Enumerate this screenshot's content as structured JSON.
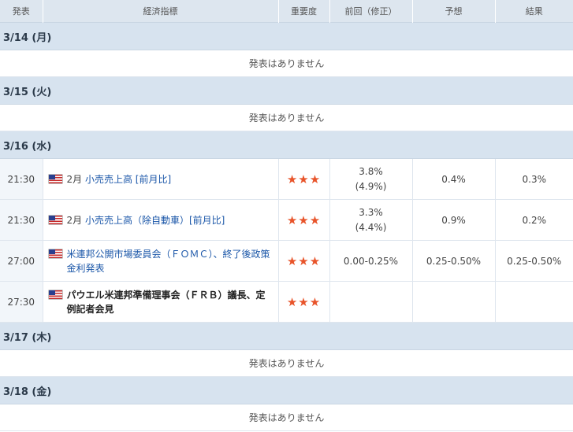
{
  "columns": [
    "発表",
    "経済指標",
    "重要度",
    "前回（修正）",
    "予想",
    "結果"
  ],
  "no_release_text": "発表はありません",
  "days": [
    {
      "date": "3/14 (月)"
    },
    {
      "date": "3/15 (火)"
    },
    {
      "date": "3/16 (水)"
    },
    {
      "date": "3/17 (木)"
    },
    {
      "date": "3/18 (金)"
    }
  ],
  "events": [
    {
      "time": "21:30",
      "month": "2月",
      "name": "小売売上高 [前月比]",
      "stars": "★★★",
      "previous": "3.8%",
      "revised": "(4.9%)",
      "forecast": "0.4%",
      "actual": "0.3%"
    },
    {
      "time": "21:30",
      "month": "2月",
      "name": "小売売上高（除自動車）[前月比]",
      "stars": "★★★",
      "previous": "3.3%",
      "revised": "(4.4%)",
      "forecast": "0.9%",
      "actual": "0.2%"
    },
    {
      "time": "27:00",
      "name": "米連邦公開市場委員会（ＦＯＭＣ）、終了後政策金利発表",
      "stars": "★★★",
      "previous": "0.00-0.25%",
      "forecast": "0.25-0.50%",
      "actual": "0.25-0.50%"
    },
    {
      "time": "27:30",
      "name": "パウエル米連邦準備理事会（ＦＲＢ）議長、定例記者会見",
      "stars": "★★★",
      "previous": "",
      "forecast": "",
      "actual": ""
    }
  ],
  "colors": {
    "header_bg": "#dde6ef",
    "date_bg": "#d7e3ef",
    "link": "#1a56a8",
    "star": "#e8542a",
    "flag": "us-flag-icon"
  }
}
